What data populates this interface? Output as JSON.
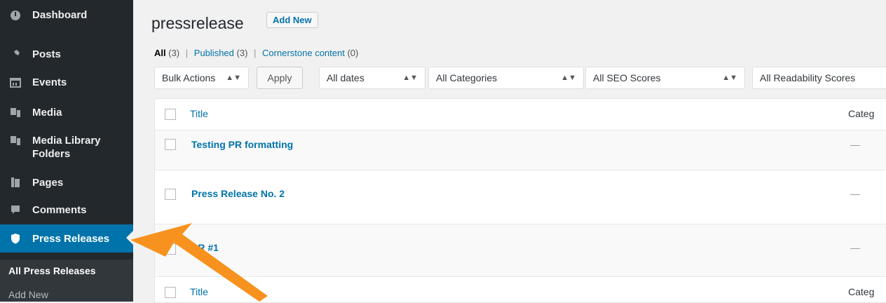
{
  "sidebar": {
    "items": [
      {
        "label": "Dashboard",
        "icon": "dashboard-icon"
      },
      {
        "label": "Posts",
        "icon": "pin-icon"
      },
      {
        "label": "Events",
        "icon": "calendar-icon"
      },
      {
        "label": "Media",
        "icon": "media-icon"
      },
      {
        "label": "Media Library Folders",
        "icon": "media-icon"
      },
      {
        "label": "Pages",
        "icon": "page-icon"
      },
      {
        "label": "Comments",
        "icon": "comment-icon"
      },
      {
        "label": "Press Releases",
        "icon": "shield-icon"
      }
    ],
    "submenu": [
      {
        "label": "All Press Releases"
      },
      {
        "label": "Add New"
      }
    ]
  },
  "page": {
    "title": "pressrelease",
    "add_new": "Add New"
  },
  "views": {
    "all_label": "All",
    "all_count": "(3)",
    "published_label": "Published",
    "published_count": "(3)",
    "cornerstone_label": "Cornerstone content",
    "cornerstone_count": "(0)",
    "separator": "|"
  },
  "filters": {
    "bulk_actions": "Bulk Actions",
    "apply": "Apply",
    "dates": "All dates",
    "categories": "All Categories",
    "seo": "All SEO Scores",
    "readability": "All Readability Scores"
  },
  "table": {
    "header_title": "Title",
    "header_categories": "Categ",
    "rows": [
      {
        "title": "Testing PR formatting",
        "category": "—"
      },
      {
        "title": "Press Release No. 2",
        "category": "—"
      },
      {
        "title": "PR #1",
        "category": "—"
      }
    ],
    "footer_title": "Title",
    "footer_categories": "Categ"
  },
  "colors": {
    "sidebar_bg": "#23282d",
    "active_bg": "#0073aa",
    "link": "#0073aa",
    "arrow": "#f7921e"
  }
}
